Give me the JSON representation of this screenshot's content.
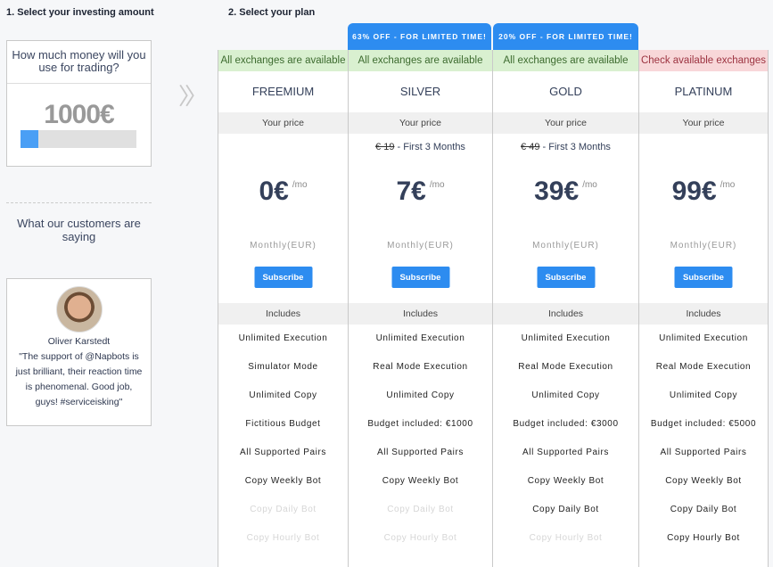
{
  "step1": "1. Select your investing amount",
  "step2": "2. Select your plan",
  "amount": {
    "question": "How much money will you use for trading?",
    "value": "1000€",
    "slider_percent": 15
  },
  "testimonials": {
    "heading": "What our customers are saying",
    "name": "Oliver Karstedt",
    "quote": "\"The support of @Napbots is just brilliant, their reaction time is phenomenal. Good job, guys! #serviceisking\""
  },
  "labels": {
    "your_price": "Your price",
    "includes": "Includes",
    "per": "/mo",
    "period": "Monthly(EUR)",
    "subscribe": "Subscribe"
  },
  "plans": [
    {
      "name": "FREEMIUM",
      "exchanges": "All exchanges are available",
      "price": "0€",
      "features": [
        "Unlimited Execution",
        "Simulator Mode",
        "Unlimited Copy",
        "Fictitious Budget",
        "All Supported Pairs",
        "Copy Weekly Bot",
        "Copy Daily Bot",
        "Copy Hourly Bot"
      ],
      "enabled": [
        1,
        1,
        1,
        1,
        1,
        1,
        0,
        0
      ]
    },
    {
      "name": "SILVER",
      "badge": "63% OFF - FOR LIMITED TIME!",
      "exchanges": "All exchanges are available",
      "old_price": "€ 19",
      "promo": "- First 3 Months",
      "price": "7€",
      "features": [
        "Unlimited Execution",
        "Real Mode Execution",
        "Unlimited Copy",
        "Budget included: €1000",
        "All Supported Pairs",
        "Copy Weekly Bot",
        "Copy Daily Bot",
        "Copy Hourly Bot"
      ],
      "enabled": [
        1,
        1,
        1,
        1,
        1,
        1,
        0,
        0
      ]
    },
    {
      "name": "GOLD",
      "badge": "20% OFF - FOR LIMITED TIME!",
      "exchanges": "All exchanges are available",
      "old_price": "€ 49",
      "promo": "- First 3 Months",
      "price": "39€",
      "features": [
        "Unlimited Execution",
        "Real Mode Execution",
        "Unlimited Copy",
        "Budget included: €3000",
        "All Supported Pairs",
        "Copy Weekly Bot",
        "Copy Daily Bot",
        "Copy Hourly Bot"
      ],
      "enabled": [
        1,
        1,
        1,
        1,
        1,
        1,
        1,
        0
      ]
    },
    {
      "name": "PLATINUM",
      "exchanges": "Check available exchanges",
      "price": "99€",
      "features": [
        "Unlimited Execution",
        "Real Mode Execution",
        "Unlimited Copy",
        "Budget included: €5000",
        "All Supported Pairs",
        "Copy Weekly Bot",
        "Copy Daily Bot",
        "Copy Hourly Bot"
      ],
      "enabled": [
        1,
        1,
        1,
        1,
        1,
        1,
        1,
        1
      ]
    }
  ]
}
